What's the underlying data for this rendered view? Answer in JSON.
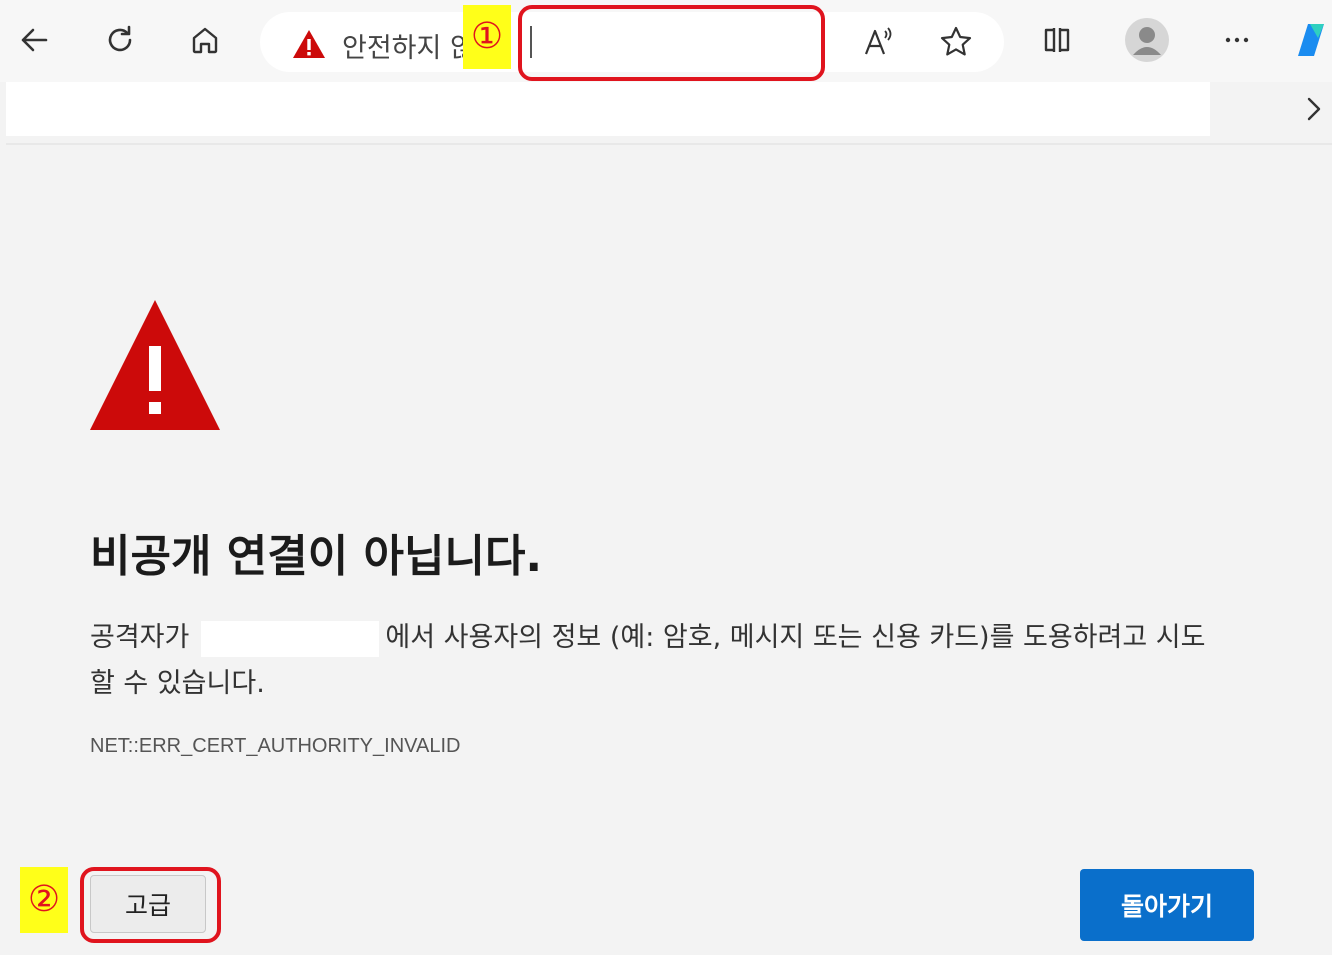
{
  "browser": {
    "address_text": "안전하지 않음",
    "address_value": "",
    "back_icon": "back-arrow-icon",
    "refresh_icon": "refresh-icon",
    "home_icon": "home-icon"
  },
  "annotations": {
    "badge_1": "①",
    "badge_2": "②",
    "color": "#e0141e",
    "highlight": "#ffff19"
  },
  "page": {
    "title": "비공개 연결이 아닙니다.",
    "desc_prefix": "공격자가",
    "desc_suffix": "에서 사용자의 정보 (예: 암호, 메시지 또는 신용 카드)를 도용하려고 시도",
    "desc_line2": "할 수 있습니다.",
    "error_code": "NET::ERR_CERT_AUTHORITY_INVALID",
    "advanced_label": "고급",
    "back_label": "돌아가기",
    "accent": "#0a6fcb",
    "warning_color": "#cc0a0a"
  }
}
